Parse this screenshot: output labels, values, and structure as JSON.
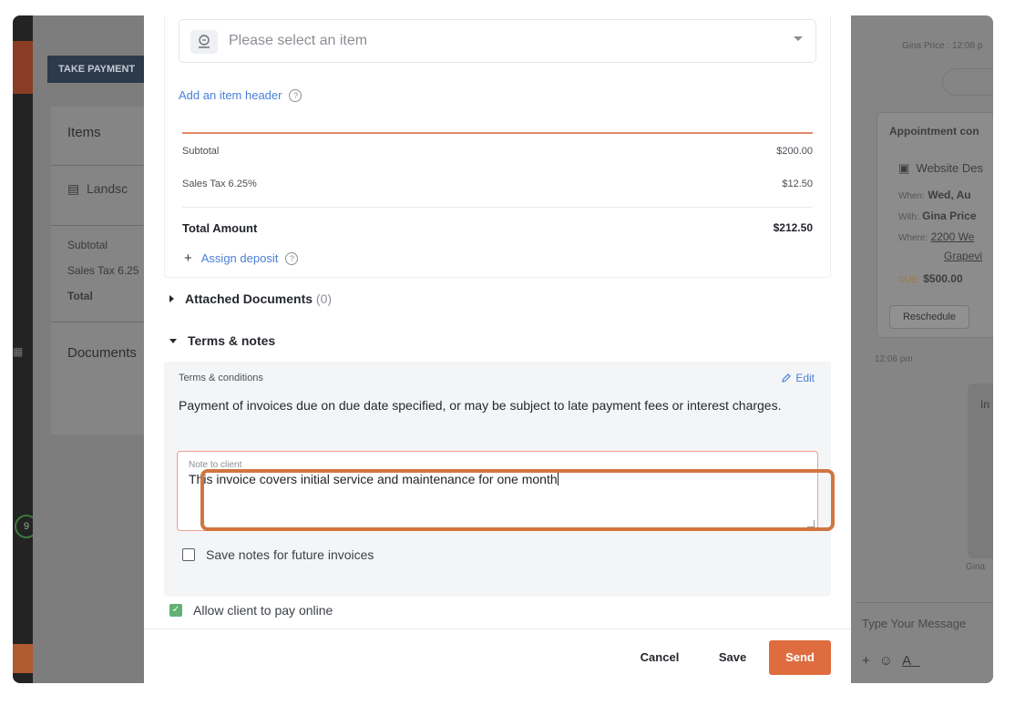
{
  "background": {
    "take_payment": "TAKE PAYMENT",
    "items_title": "Items",
    "item_name": "Landsc",
    "subtotal": "Subtotal",
    "sales_tax": "Sales Tax 6.25",
    "total": "Total",
    "documents": "Documents",
    "sidebar_badge": "9",
    "sender_time": "Gina Price : 12:08 p",
    "appointment_title": "Appointment con",
    "appointment_name": "Website Des",
    "when_label": "When:",
    "when_value": "Wed, Au",
    "with_label": "With:",
    "with_value": "Gina Price",
    "where_label": "Where:",
    "where_value_1": "2200 We",
    "where_value_2": "Grapevi",
    "due_label": "DUE:",
    "due_value": "$500.00",
    "reschedule": "Reschedule",
    "time_stamp": "12:06 pm",
    "bubble_title": "In",
    "bubble_footer": "Gina",
    "message_placeholder": "Type Your Message"
  },
  "modal": {
    "item_select_placeholder": "Please select an item",
    "add_item_header": "Add an item header",
    "summary": {
      "subtotal_label": "Subtotal",
      "subtotal_value": "$200.00",
      "tax_label": "Sales Tax 6.25%",
      "tax_value": "$12.50",
      "total_label": "Total Amount",
      "total_value": "$212.50"
    },
    "assign_deposit": "Assign deposit",
    "attached_documents": {
      "label": "Attached Documents",
      "count": "(0)"
    },
    "terms_notes": {
      "label": "Terms & notes",
      "terms_label": "Terms & conditions",
      "edit": "Edit",
      "terms_text": "Payment of invoices due on due date specified, or may be subject to late payment fees or interest charges.",
      "note_label": "Note to client",
      "note_value": "This invoice covers initial service and maintenance for one month",
      "save_notes": "Save notes for future invoices"
    },
    "allow_online": "Allow client to pay online",
    "footer": {
      "cancel": "Cancel",
      "save": "Save",
      "send": "Send"
    }
  },
  "colors": {
    "accent": "#de6c3f",
    "link": "#4a7fd6",
    "check": "#61b174"
  }
}
